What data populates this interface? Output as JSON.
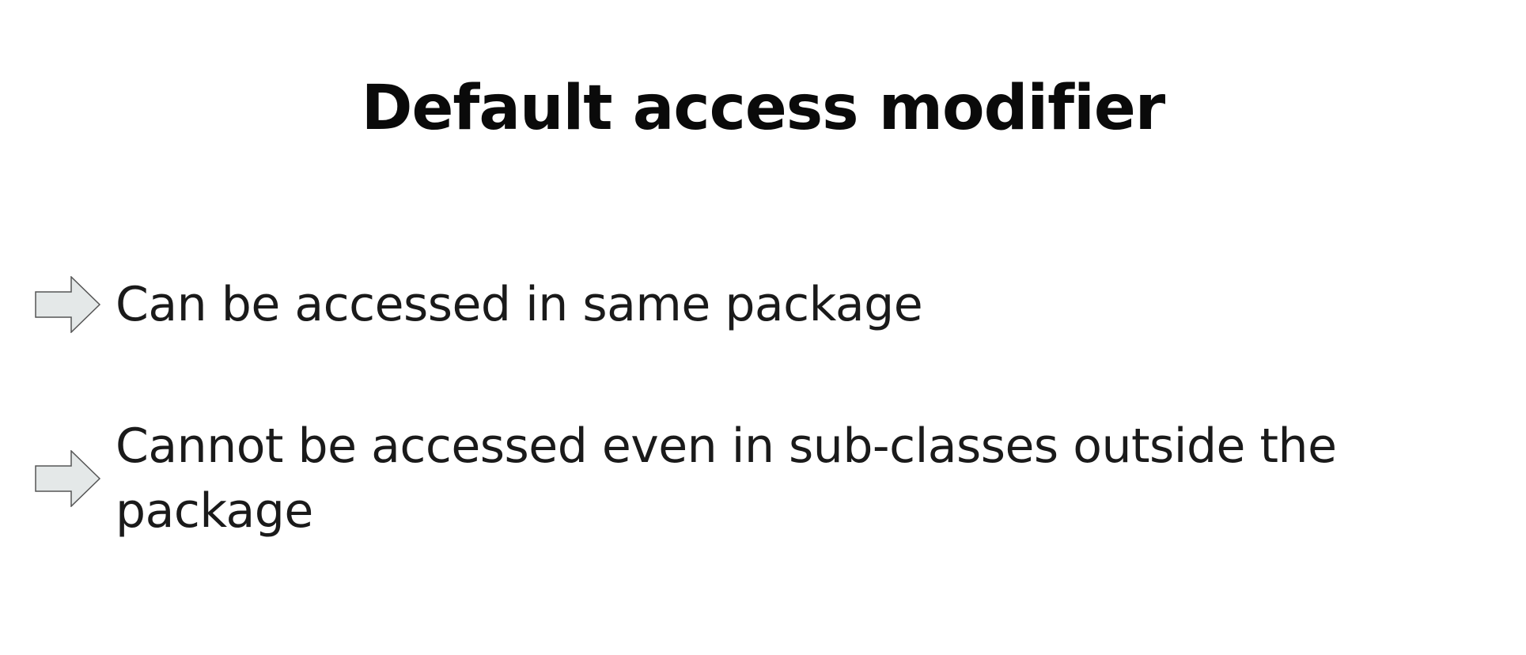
{
  "slide": {
    "title": "Default access modifier",
    "bullets": [
      {
        "text": "Can be accessed in same package",
        "icon": "right-arrow-icon"
      },
      {
        "text": "Cannot be accessed even in sub-classes outside the package",
        "icon": "right-arrow-icon"
      }
    ],
    "colors": {
      "background": "#ffffff",
      "text": "#111111",
      "arrow_fill": "#e4e8e8",
      "arrow_stroke": "#555555"
    }
  }
}
